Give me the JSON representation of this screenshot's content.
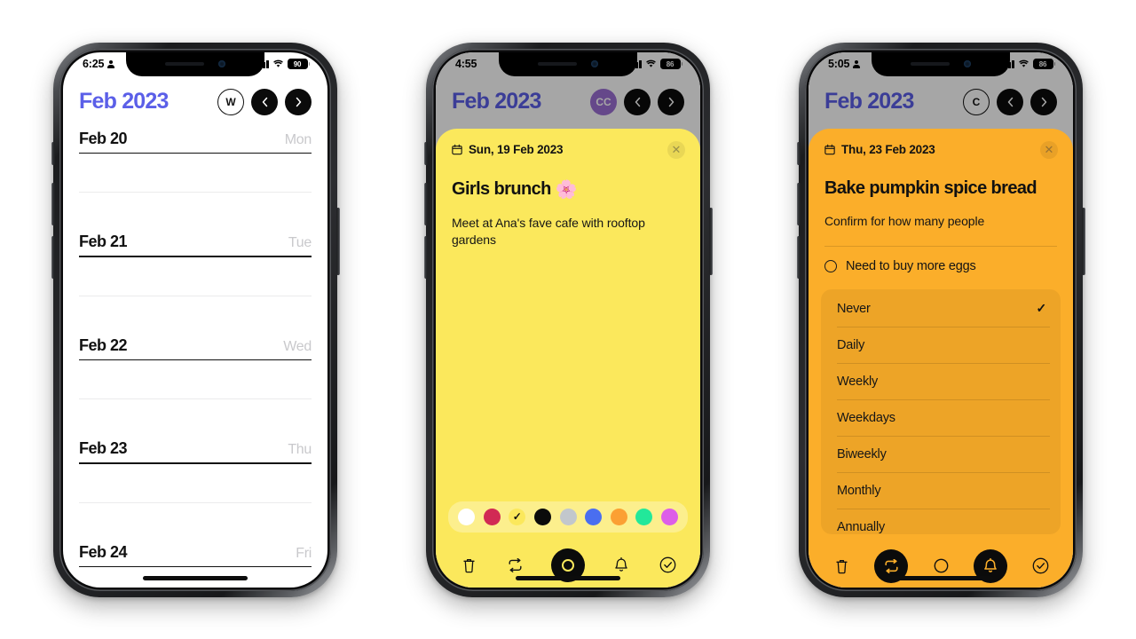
{
  "phones": [
    {
      "id": "calendar",
      "status": {
        "time": "6:25",
        "person_icon": "person-icon",
        "signal_icon": "signal-bars-icon",
        "wifi_icon": "wifi-icon",
        "battery": "90"
      },
      "header": {
        "title": "Feb 2023",
        "avatar": "W",
        "prev_icon": "chevron-left-icon",
        "next_icon": "chevron-right-icon"
      },
      "days": [
        {
          "date": "Feb 20",
          "weekday": "Mon"
        },
        {
          "date": "Feb 21",
          "weekday": "Tue"
        },
        {
          "date": "Feb 22",
          "weekday": "Wed"
        },
        {
          "date": "Feb 23",
          "weekday": "Thu"
        },
        {
          "date": "Feb 24",
          "weekday": "Fri"
        }
      ],
      "accent": "#5b5fe8"
    },
    {
      "id": "event-detail-yellow",
      "status": {
        "time": "4:55",
        "signal_icon": "signal-bars-icon",
        "wifi_icon": "wifi-icon",
        "battery": "86"
      },
      "header": {
        "title": "Feb 2023",
        "avatar": "CC",
        "avatar_color": "#9b6fd4",
        "prev_icon": "chevron-left-icon",
        "next_icon": "chevron-right-icon"
      },
      "card": {
        "bg": "#fbe85c",
        "date_icon": "calendar-icon",
        "date": "Sun, 19 Feb 2023",
        "close_icon": "close-icon",
        "title": "Girls brunch",
        "title_emoji": "🌸",
        "body": "Meet at Ana's fave cafe with rooftop gardens",
        "palette": [
          {
            "name": "white",
            "hex": "#ffffff",
            "selected": false
          },
          {
            "name": "crimson",
            "hex": "#d12a54",
            "selected": false
          },
          {
            "name": "yellow",
            "hex": "#fbe85c",
            "selected": true
          },
          {
            "name": "black",
            "hex": "#0b0b0b",
            "selected": false
          },
          {
            "name": "gray",
            "hex": "#c2c7cc",
            "selected": false
          },
          {
            "name": "blue",
            "hex": "#4a6ef0",
            "selected": false
          },
          {
            "name": "orange",
            "hex": "#fba033",
            "selected": false
          },
          {
            "name": "green",
            "hex": "#22e89a",
            "selected": false
          },
          {
            "name": "magenta",
            "hex": "#dd5ee8",
            "selected": false
          }
        ],
        "toolbar": [
          {
            "name": "delete-icon",
            "active": false
          },
          {
            "name": "repeat-icon",
            "active": false
          },
          {
            "name": "color-icon",
            "active": true
          },
          {
            "name": "reminder-icon",
            "active": false
          },
          {
            "name": "complete-icon",
            "active": false
          }
        ]
      }
    },
    {
      "id": "event-detail-orange",
      "status": {
        "time": "5:05",
        "person_icon": "person-icon",
        "signal_icon": "signal-bars-icon",
        "wifi_icon": "wifi-icon",
        "battery": "86"
      },
      "header": {
        "title": "Feb 2023",
        "avatar": "C",
        "prev_icon": "chevron-left-icon",
        "next_icon": "chevron-right-icon"
      },
      "card": {
        "bg": "#fbae2a",
        "date_icon": "calendar-icon",
        "date": "Thu, 23 Feb 2023",
        "close_icon": "close-icon",
        "title": "Bake pumpkin spice bread",
        "body": "Confirm for how many people",
        "subtask": {
          "radio_icon": "radio-unchecked-icon",
          "label": "Need to buy more eggs"
        },
        "repeat_options": [
          {
            "label": "Never",
            "selected": true
          },
          {
            "label": "Daily",
            "selected": false
          },
          {
            "label": "Weekly",
            "selected": false
          },
          {
            "label": "Weekdays",
            "selected": false
          },
          {
            "label": "Biweekly",
            "selected": false
          },
          {
            "label": "Monthly",
            "selected": false
          },
          {
            "label": "Annually",
            "selected": false
          }
        ],
        "check_glyph": "✓",
        "toolbar": [
          {
            "name": "delete-icon",
            "active": false
          },
          {
            "name": "repeat-icon",
            "active": true
          },
          {
            "name": "color-icon",
            "active": false
          },
          {
            "name": "reminder-icon",
            "active": true
          },
          {
            "name": "complete-icon",
            "active": false
          }
        ]
      }
    }
  ]
}
